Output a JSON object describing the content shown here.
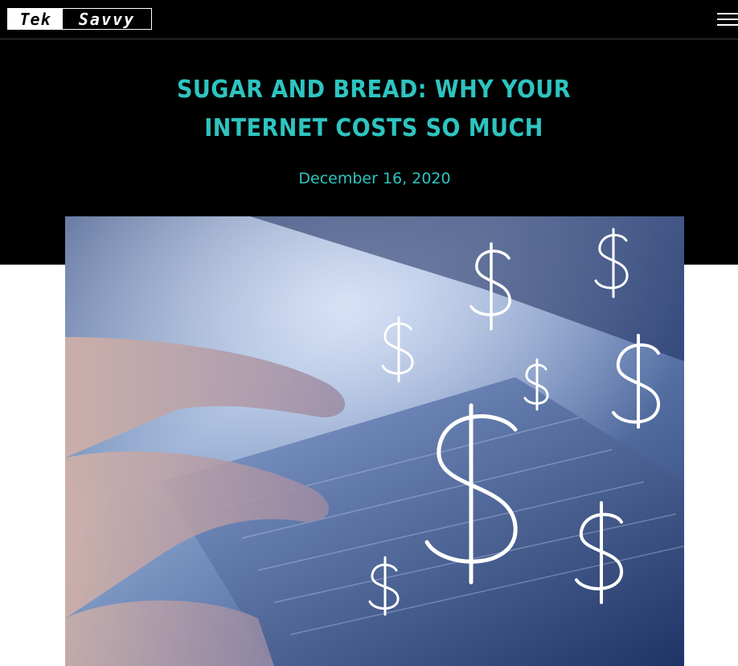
{
  "header": {
    "logo_left": "Tek",
    "logo_right": "Savvy",
    "menu_icon": "hamburger-menu-icon"
  },
  "article": {
    "title": "SUGAR AND BREAD: WHY YOUR INTERNET COSTS SO MUCH",
    "date": "December 16, 2020"
  },
  "colors": {
    "accent": "#2ec4c0",
    "background": "#000000",
    "page": "#ffffff"
  },
  "image": {
    "icon": "dollar-sign-icon"
  }
}
